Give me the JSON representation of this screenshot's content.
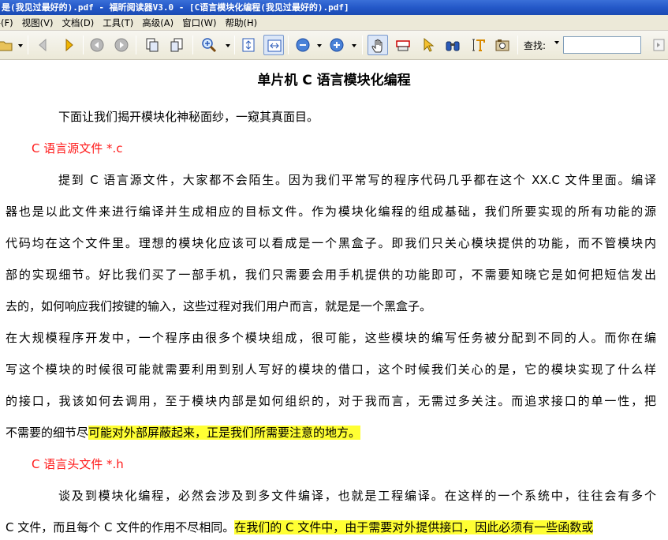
{
  "window": {
    "title": "是(我见过最好的).pdf - 福昕阅读器V3.0 - [C语言模块化编程(我见过最好的).pdf]"
  },
  "menu": [
    "文件(F)",
    "视图(V)",
    "文档(D)",
    "工具(T)",
    "高级(A)",
    "窗口(W)",
    "帮助(H)"
  ],
  "toolbar": {
    "icons": [
      "open-icon",
      "back-icon",
      "forward-icon",
      "prev-page-icon",
      "next-page-icon",
      "copy-page-icon",
      "paste-page-icon",
      "zoom-in-tool-icon",
      "fit-page-icon",
      "fit-width-icon",
      "zoom-out-icon",
      "zoom-in-icon",
      "hand-tool-icon",
      "typewriter-icon",
      "select-tool-icon",
      "binoculars-icon",
      "text-select-icon",
      "snapshot-icon"
    ],
    "find_label": "查找:",
    "find_value": ""
  },
  "document": {
    "title": "单片机 C 语言模块化编程",
    "lines": [
      "下面让我们揭开模块化神秘面纱，一窥其真面目。",
      "C 语言源文件 *.c",
      "提到 C 语言源文件，大家都不会陌生。因为我们平常写的程序代码几乎都在这个 XX.C 文件里面。编译",
      "器也是以此文件来进行编译并生成相应的目标文件。作为模块化编程的组成基础，我们所要实现的所有功能的源",
      "代码均在这个文件里。理想的模块化应该可以看成是一个黑盒子。即我们只关心模块提供的功能，而不管模块内",
      "部的实现细节。好比我们买了一部手机，我们只需要会用手机提供的功能即可，不需要知晓它是如何把短信发出",
      "去的，如何响应我们按键的输入，这些过程对我们用户而言，就是是一个黑盒子。",
      "在大规模程序开发中，一个程序由很多个模块组成，很可能，这些模块的编写任务被分配到不同的人。而你在编",
      "写这个模块的时候很可能就需要利用到别人写好的模块的借口，这个时候我们关心的是，它的模块实现了什么样",
      "的接口，我该如何去调用，至于模块内部是如何组织的，对于我而言，无需过多关注。而追求接口的单一性，把",
      "不需要的细节尽",
      "可能对外部屏蔽起来，正是我们所需要注意的地方。",
      "C 语言头文件 *.h",
      "谈及到模块化编程，必然会涉及到多文件编译，也就是工程编译。在这样的一个系统中，往往会有多个",
      "C 文件，而且每个 C 文件的作用不尽相同。",
      "在我们的 C 文件中，由于需要对外提供接口，因此必须有一些函数或"
    ]
  },
  "colors": {
    "heading": "#ff1a1a",
    "highlight": "#ffff33",
    "titlebar": "#2458c8"
  }
}
